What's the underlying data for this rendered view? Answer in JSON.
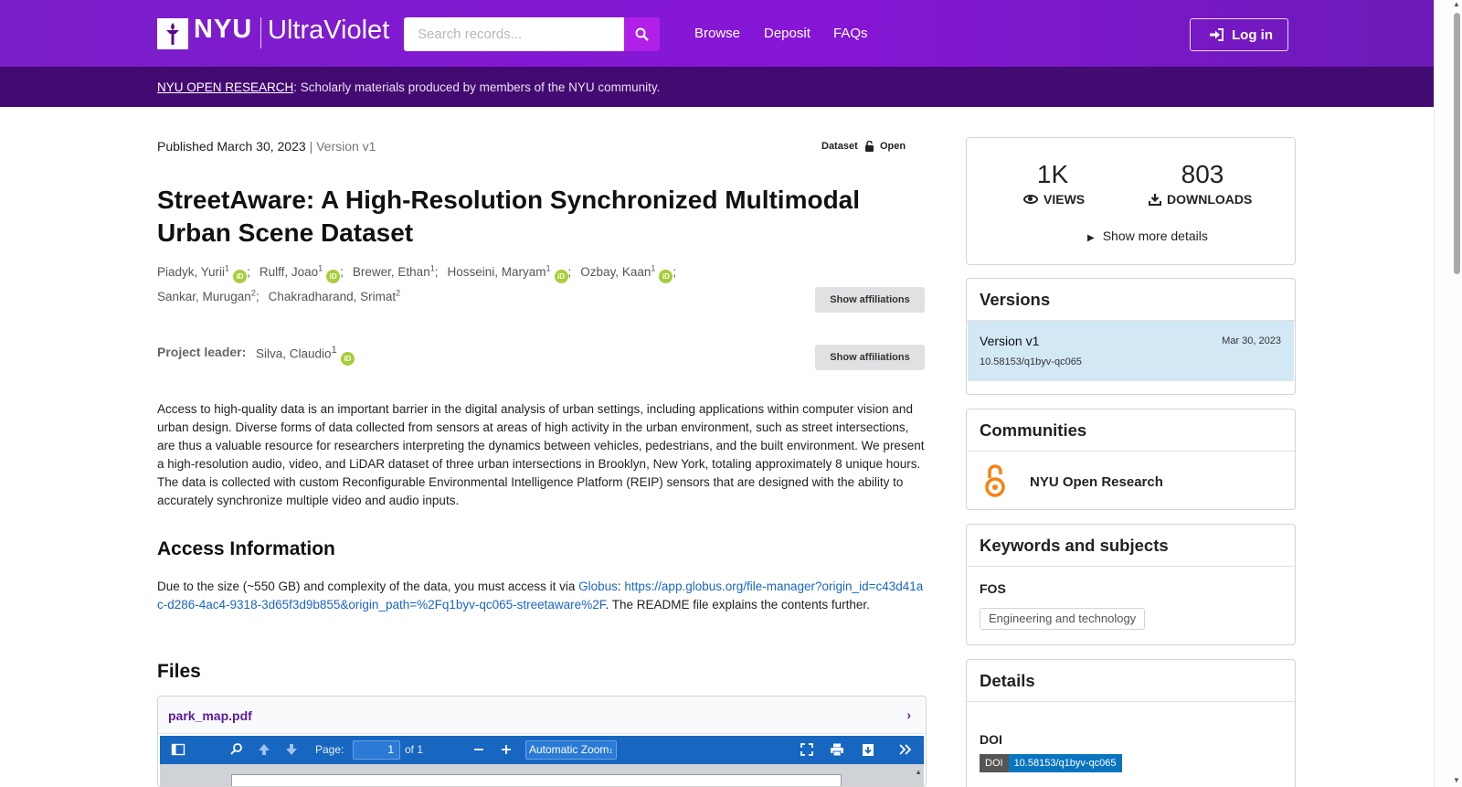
{
  "header": {
    "logo_nyu": "NYU",
    "logo_product": "UltraViolet",
    "search_placeholder": "Search records...",
    "nav": [
      "Browse",
      "Deposit",
      "FAQs"
    ],
    "login_label": "Log in",
    "colors": {
      "header": "#8716d6",
      "subbar": "#430b72",
      "search_button": "#b020e8"
    }
  },
  "community_banner": {
    "link": "NYU OPEN RESEARCH",
    "text": ": Scholarly materials produced by members of the NYU community."
  },
  "record": {
    "published": "Published March 30, 2023",
    "version": "| Version v1",
    "resource_type": "Dataset",
    "access": "Open",
    "title": "StreetAware: A High-Resolution Synchronized Multimodal Urban Scene Dataset",
    "creators_row1": [
      {
        "name": "Piadyk, Yurii",
        "aff": "1",
        "orcid": true,
        "sep": ";"
      },
      {
        "name": "Rulff, Joao",
        "aff": "1",
        "orcid": true,
        "sep": ";"
      },
      {
        "name": "Brewer, Ethan",
        "aff": "1",
        "orcid": false,
        "sep": ";"
      },
      {
        "name": "Hosseini, Maryam",
        "aff": "1",
        "orcid": true,
        "sep": ";"
      },
      {
        "name": "Ozbay, Kaan",
        "aff": "1",
        "orcid": true,
        "sep": ";"
      }
    ],
    "creators_row2": [
      {
        "name": "Sankar, Murugan",
        "aff": "2",
        "orcid": false,
        "sep": ";"
      },
      {
        "name": "Chakradharand, Srimat",
        "aff": "2",
        "orcid": false,
        "sep": ""
      }
    ],
    "show_affiliations": "Show affiliations",
    "project_leader_label": "Project leader:",
    "project_leader": {
      "name": "Silva, Claudio",
      "aff": "1"
    },
    "description": "Access to high-quality data is an important barrier in the digital analysis of urban settings, including applications within computer vision and urban design. Diverse forms of data collected from sensors at areas of high activity in the urban environment, such as street intersections, are thus a valuable resource for researchers interpreting the dynamics between vehicles, pedestrians, and the built environment. We present a high-resolution audio, video, and LiDAR dataset of three urban intersections in Brooklyn, New York, totaling approximately 8 unique hours. The data is collected with custom Reconfigurable Environmental Intelligence Platform (REIP) sensors that are designed with the ability to accurately synchronize multiple video and audio inputs.",
    "access_heading": "Access Information",
    "access_text_1": "Due to the size (~550 GB) and complexity of the data, you must access it via ",
    "access_link_globus": "Globus",
    "access_colon": ": ",
    "access_link_url": "https://app.globus.org/file-manager?origin_id=c43d41ac-d286-4ac4-9318-3d65f3d9b855&origin_path=%2Fq1byv-qc065-streetaware%2F",
    "access_text_2": ". The README file explains the contents further.",
    "files_heading": "Files",
    "file_name": "park_map.pdf",
    "pdf_toolbar": {
      "page_label": "Page:",
      "page_value": "1",
      "of_label": "of 1",
      "zoom": "Automatic Zoom"
    }
  },
  "sidebar": {
    "stats": {
      "views": "1K",
      "views_label": "VIEWS",
      "downloads": "803",
      "downloads_label": "DOWNLOADS",
      "more": "Show more details"
    },
    "versions": {
      "heading": "Versions",
      "name": "Version v1",
      "date": "Mar 30, 2023",
      "doi": "10.58153/q1byv-qc065"
    },
    "communities": {
      "heading": "Communities",
      "name": "NYU Open Research"
    },
    "keywords": {
      "heading": "Keywords and subjects",
      "fos_label": "FOS",
      "chip": "Engineering and technology"
    },
    "details": {
      "heading": "Details",
      "doi_label": "DOI",
      "doi_badge_left": "DOI",
      "doi_badge_right": "10.58153/q1byv-qc065"
    }
  }
}
